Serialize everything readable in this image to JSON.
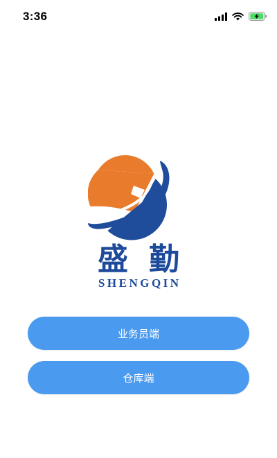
{
  "status_bar": {
    "time": "3:36",
    "icons": [
      "signal-icon",
      "wifi-icon",
      "battery-charging-icon"
    ]
  },
  "brand": {
    "name_cn": "盛勤",
    "name_en": "SHENGQIN",
    "logo_colors": {
      "orange": "#e97c2c",
      "blue": "#1f4d9c"
    }
  },
  "buttons": {
    "salesperson": "业务员端",
    "warehouse": "仓库端"
  },
  "colors": {
    "button_bg": "#4a9aef",
    "button_text": "#ffffff",
    "brand_text": "#1d4a9a"
  }
}
